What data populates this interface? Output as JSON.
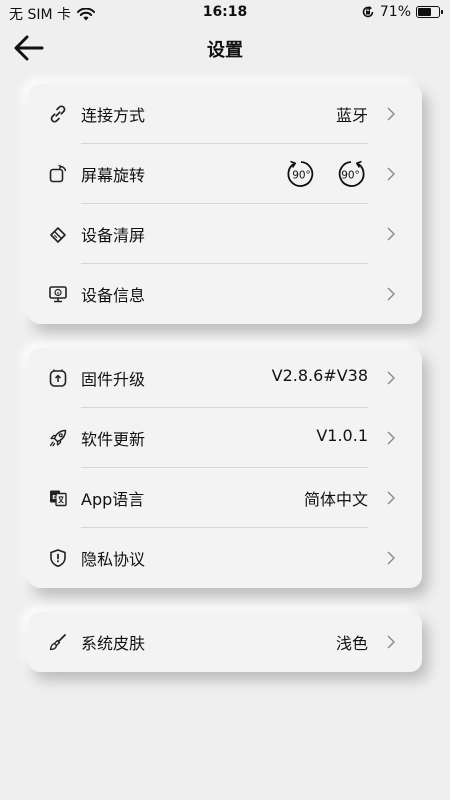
{
  "status_bar": {
    "carrier": "无 SIM 卡",
    "time": "16:18",
    "battery_percent": "71%",
    "battery_level": 0.71
  },
  "header": {
    "title": "设置"
  },
  "groups": [
    {
      "items": [
        {
          "label": "连接方式",
          "value": "蓝牙",
          "icon": "link-icon"
        },
        {
          "label": "屏幕旋转",
          "value": "",
          "icon": "screen-rotate-icon",
          "rotate_left": "90°",
          "rotate_right": "90°"
        },
        {
          "label": "设备清屏",
          "value": "",
          "icon": "eraser-icon"
        },
        {
          "label": "设备信息",
          "value": "",
          "icon": "monitor-info-icon"
        }
      ]
    },
    {
      "items": [
        {
          "label": "固件升级",
          "value": "V2.8.6#V38",
          "icon": "firmware-upgrade-icon"
        },
        {
          "label": "软件更新",
          "value": "V1.0.1",
          "icon": "rocket-icon"
        },
        {
          "label": "App语言",
          "value": "简体中文",
          "icon": "language-icon"
        },
        {
          "label": "隐私协议",
          "value": "",
          "icon": "shield-icon"
        }
      ]
    },
    {
      "items": [
        {
          "label": "系统皮肤",
          "value": "浅色",
          "icon": "paint-brush-icon"
        }
      ]
    }
  ]
}
